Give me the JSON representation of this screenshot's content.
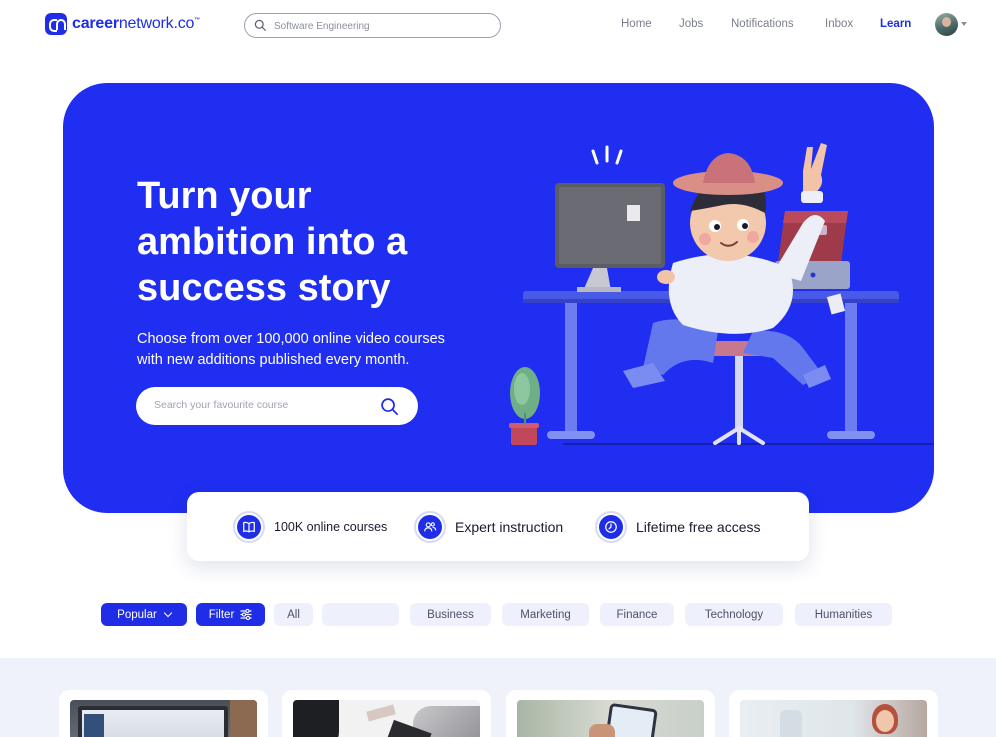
{
  "brand": {
    "name_bold": "career",
    "name_light": "network.co",
    "tm": "™"
  },
  "top_search": {
    "placeholder": "Software Engineering"
  },
  "nav": {
    "items": [
      {
        "label": "Home",
        "active": false
      },
      {
        "label": "Jobs",
        "active": false
      },
      {
        "label": "Notifications",
        "active": false
      },
      {
        "label": "Inbox",
        "active": false
      },
      {
        "label": "Learn",
        "active": true
      }
    ]
  },
  "hero": {
    "title_lines": [
      "Turn your",
      "ambition into a",
      "success story"
    ],
    "subtitle_lines": [
      "Choose from over 100,000 online video courses",
      "with new additions published every month."
    ],
    "search_placeholder": "Search your favourite course"
  },
  "features": [
    {
      "icon": "book-icon",
      "label": "100K online courses"
    },
    {
      "icon": "users-icon",
      "label": "Expert instruction"
    },
    {
      "icon": "clock-icon",
      "label": "Lifetime free access"
    }
  ],
  "filters": {
    "sort_label": "Popular",
    "filter_label": "Filter",
    "categories": [
      "All",
      "",
      "Business",
      "Marketing",
      "Finance",
      "Technology",
      "Humanities"
    ]
  },
  "colors": {
    "brand": "#1f2ee6",
    "hero_bg": "#1f2ef0",
    "chip_bg": "#eef0fb",
    "section_bg": "#eff1fb"
  },
  "courses": [
    {
      "thumbnail": "laptop-dashboard"
    },
    {
      "thumbnail": "desk-laptop"
    },
    {
      "thumbnail": "phone-hand"
    },
    {
      "thumbnail": "smiling-woman"
    }
  ]
}
